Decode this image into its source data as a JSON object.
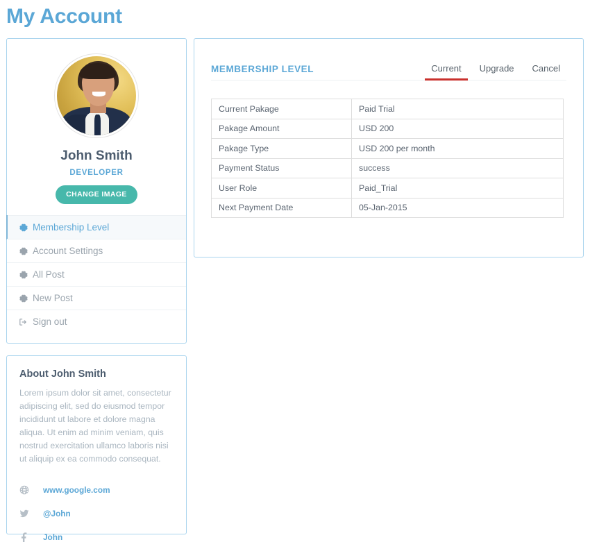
{
  "page": {
    "title": "My Account"
  },
  "profile": {
    "avatar_icon": "user-avatar-photo",
    "name": "John Smith",
    "role": "DEVELOPER",
    "change_image_label": "CHANGE IMAGE",
    "menu": [
      {
        "label": "Membership Level",
        "icon": "gear-icon",
        "active": true
      },
      {
        "label": "Account Settings",
        "icon": "gear-icon",
        "active": false
      },
      {
        "label": "All Post",
        "icon": "gear-icon",
        "active": false
      },
      {
        "label": "New Post",
        "icon": "gear-icon",
        "active": false
      },
      {
        "label": "Sign out",
        "icon": "sign-out-icon",
        "active": false
      }
    ]
  },
  "about": {
    "title": "About John Smith",
    "text": "Lorem ipsum dolor sit amet, consectetur adipiscing elit, sed do eiusmod tempor incididunt ut labore et dolore magna aliqua. Ut enim ad minim veniam, quis nostrud exercitation ullamco laboris nisi ut aliquip ex ea commodo consequat.",
    "social": [
      {
        "icon": "globe-icon",
        "label": "www.google.com"
      },
      {
        "icon": "twitter-icon",
        "label": "@John"
      },
      {
        "icon": "facebook-icon",
        "label": "John"
      }
    ]
  },
  "membership": {
    "heading": "MEMBERSHIP LEVEL",
    "tabs": [
      {
        "label": "Current",
        "active": true
      },
      {
        "label": "Upgrade",
        "active": false
      },
      {
        "label": "Cancel",
        "active": false
      }
    ],
    "rows": [
      {
        "label": "Current Pakage",
        "value": "Paid Trial"
      },
      {
        "label": "Pakage Amount",
        "value": "USD 200"
      },
      {
        "label": "Pakage Type",
        "value": "USD 200 per month"
      },
      {
        "label": "Payment Status",
        "value": "success"
      },
      {
        "label": "User Role",
        "value": "Paid_Trial"
      },
      {
        "label": "Next Payment Date",
        "value": "05-Jan-2015"
      }
    ]
  },
  "colors": {
    "accent_blue": "#5ba7d6",
    "card_border": "#a9d4ee",
    "teal_button": "#47b8ab",
    "tab_underline_red": "#c9302c",
    "text_dark": "#4c5c6e",
    "text_muted": "#9aa4ad"
  }
}
